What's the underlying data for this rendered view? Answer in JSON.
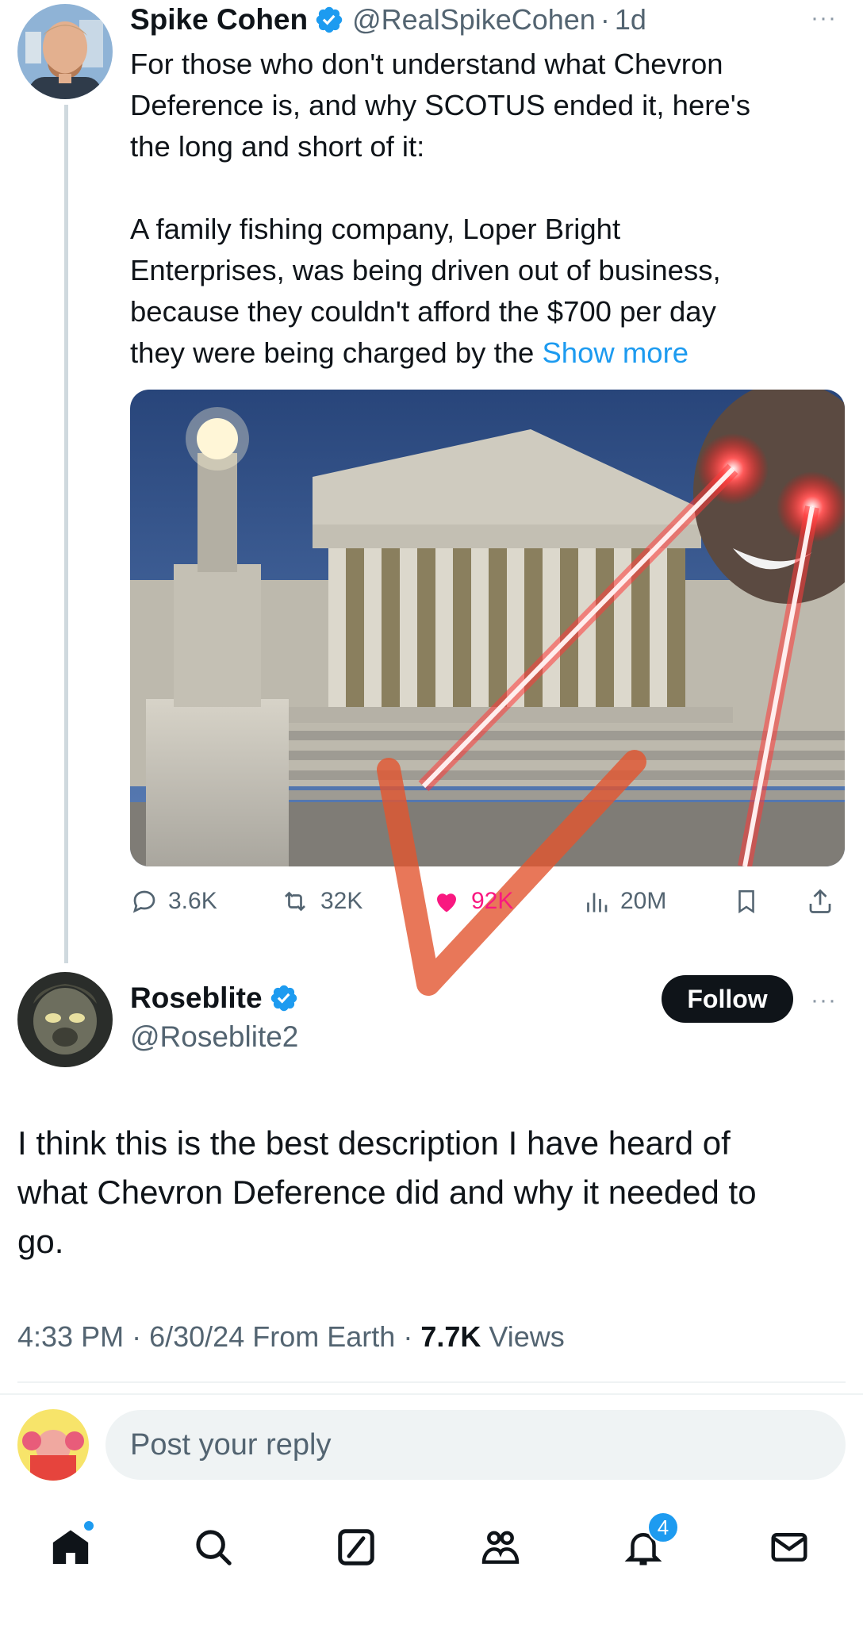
{
  "quoted_tweet": {
    "author_name": "Spike Cohen",
    "handle": "@RealSpikeCohen",
    "separator": "·",
    "age": "1d",
    "more_label": "···",
    "text_lines": [
      "For those who don't understand what Chevron",
      "Deference is, and why SCOTUS ended it, here's",
      "the long and short of it:",
      "A family fishing company, Loper Bright",
      "Enterprises, was being driven out of business,",
      "because they couldn't afford the $700 per day",
      "they were being charged by the "
    ],
    "show_more": "Show more",
    "stats": {
      "replies": "3.6K",
      "reposts": "32K",
      "likes": "92K",
      "views": "20M"
    }
  },
  "reply_tweet": {
    "author_name": "Roseblite",
    "handle": "@Roseblite2",
    "follow_label": "Follow",
    "more_label": "···",
    "text_lines": [
      "I think this is the best description I have heard of",
      "what Chevron Deference did and why it needed to",
      "go."
    ],
    "meta": {
      "time": "4:33 PM",
      "date": "6/30/24",
      "source": "From Earth",
      "views_count": "7.7K",
      "views_label": "Views",
      "separator": "·"
    }
  },
  "compose": {
    "placeholder": "Post your reply"
  },
  "tabbar": {
    "notifications_badge": "4"
  },
  "colors": {
    "accent": "#1d9bf0",
    "like": "#f91880",
    "text": "#0f1419",
    "muted": "#536471"
  }
}
